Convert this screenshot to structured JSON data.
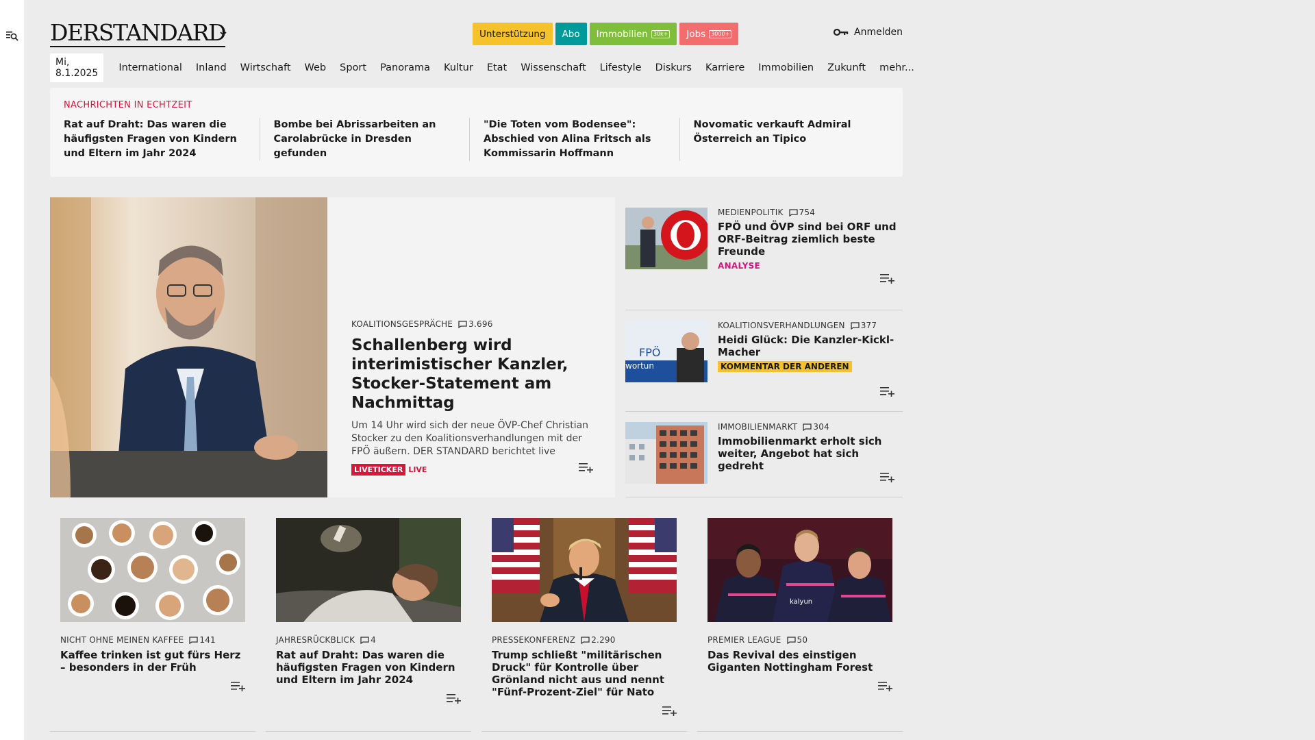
{
  "header": {
    "logo": "DERSTANDARD",
    "pills": {
      "support": "Unterstützung",
      "abo": "Abo",
      "immobilien": "Immobilien",
      "immobilien_badge": "30k+",
      "jobs": "Jobs",
      "jobs_badge": "3000+"
    },
    "login": "Anmelden"
  },
  "nav": {
    "date": "Mi, 8.1.2025",
    "items": [
      "International",
      "Inland",
      "Wirtschaft",
      "Web",
      "Sport",
      "Panorama",
      "Kultur",
      "Etat",
      "Wissenschaft",
      "Lifestyle",
      "Diskurs",
      "Karriere",
      "Immobilien",
      "Zukunft",
      "mehr..."
    ]
  },
  "ticker": {
    "title": "NACHRICHTEN IN ECHTZEIT",
    "items": [
      "Rat auf Draht: Das waren die häufigs­ten Fragen von Kindern und Eltern im Jahr 2024",
      "Bombe bei Abrissarbeiten an Carolab­rücke in Dresden gefunden",
      "\"Die Toten vom Bodensee\": Abschied von Alina Fritsch als Kommissarin Hoffmann",
      "Novomatic verkauft Admiral Öster­reich an Tipico"
    ]
  },
  "hero": {
    "kicker": "KOALITIONSGESPRÄCHE",
    "comments": "3.696",
    "title": "Schallenberg wird interimisti­scher Kanzler, Stocker-State­ment am Nachmittag",
    "teaser": "Um 14 Uhr wird sich der neue ÖVP-Chef Christian Stocker zu den Koalitionsverhandlungen mit der FPÖ äußern. DER STANDARD berichtet live",
    "tag_ticker": "LIVETICKER",
    "tag_live": "LIVE"
  },
  "side": [
    {
      "kicker": "MEDIENPOLITIK",
      "comments": "754",
      "title": "FPÖ und ÖVP sind bei ORF und ORF-Beitrag ziemlich beste Freunde",
      "tag": "ANALYSE"
    },
    {
      "kicker": "KOALITIONSVERHANDLUNGEN",
      "comments": "377",
      "title": "Heidi Glück: Die Kanzler-Kickl-Macher",
      "tag": "KOMMENTAR DER ANDEREN"
    },
    {
      "kicker": "IMMOBILIENMARKT",
      "comments": "304",
      "title": "Immobilienmarkt erholt sich weiter, Angebot hat sich gedreht"
    }
  ],
  "cards": [
    {
      "kicker": "NICHT OHNE MEINEN KAFFEE",
      "comments": "141",
      "title": "Kaffee trinken ist gut fürs Herz – besonders in der Früh"
    },
    {
      "kicker": "JAHRESRÜCKBLICK",
      "comments": "4",
      "title": "Rat auf Draht: Das waren die häufigsten Fragen von Kindern und Eltern im Jahr 2024"
    },
    {
      "kicker": "PRESSEKONFERENZ",
      "comments": "2.290",
      "title": "Trump schließt \"militärischen Druck\" für Kontrolle über Grönland nicht aus und nennt \"Fünf-Prozent-Ziel\" für Nato"
    },
    {
      "kicker": "PREMIER LEAGUE",
      "comments": "50",
      "title": "Das Revival des einstigen Giganten Nottingham Forest"
    }
  ],
  "colors": {
    "accent_red": "#d6173a",
    "analyse_magenta": "#d4157e",
    "support_yellow": "#f6c22b",
    "abo_teal": "#009a9a",
    "immo_green": "#7fbe3a",
    "jobs_salmon": "#f26e6e"
  }
}
